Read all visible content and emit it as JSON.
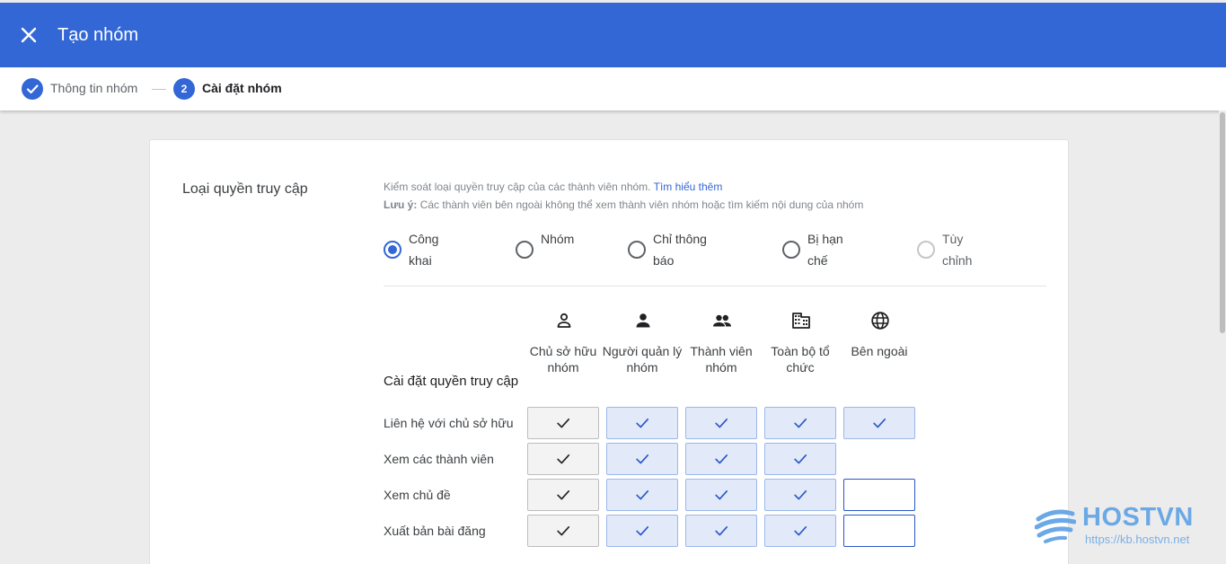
{
  "header": {
    "title": "Tạo nhóm",
    "close_icon": "close-icon"
  },
  "stepper": {
    "steps": [
      {
        "label": "Thông tin nhóm",
        "state": "done",
        "icon": "check-icon"
      },
      {
        "label": "Cài đặt nhóm",
        "number": "2",
        "state": "active"
      }
    ]
  },
  "access": {
    "section_title": "Loại quyền truy cập",
    "description": "Kiểm soát loại quyền truy cập của các thành viên nhóm.",
    "learn_more": "Tìm hiểu thêm",
    "note_label": "Lưu ý:",
    "note_text": "Các thành viên bên ngoài không thể xem thành viên nhóm hoặc tìm kiếm nội dung của nhóm",
    "options": [
      {
        "line1": "Công",
        "line2": "khai",
        "selected": true
      },
      {
        "line1": "Nhóm",
        "line2": "",
        "selected": false
      },
      {
        "line1": "Chỉ thông",
        "line2": "báo",
        "selected": false
      },
      {
        "line1": "Bị hạn",
        "line2": "chế",
        "selected": false
      },
      {
        "line1": "Tùy",
        "line2": "chỉnh",
        "selected": false,
        "disabled": true
      }
    ]
  },
  "permissions": {
    "title": "Cài đặt quyền truy cập",
    "columns": [
      {
        "label": "Chủ sở hữu nhóm",
        "icon": "person-outline-icon"
      },
      {
        "label": "Người quản lý nhóm",
        "icon": "person-icon"
      },
      {
        "label": "Thành viên nhóm",
        "icon": "people-icon"
      },
      {
        "label": "Toàn bộ tổ chức",
        "icon": "building-icon"
      },
      {
        "label": "Bên ngoài",
        "icon": "globe-icon"
      }
    ],
    "rows": [
      {
        "label": "Liên hệ với chủ sở hữu",
        "cells": [
          "checked",
          "checked",
          "checked",
          "checked",
          "checked"
        ]
      },
      {
        "label": "Xem các thành viên",
        "cells": [
          "checked",
          "checked",
          "checked",
          "checked",
          "none"
        ]
      },
      {
        "label": "Xem chủ đề",
        "cells": [
          "checked",
          "checked",
          "checked",
          "checked",
          "unchecked"
        ]
      },
      {
        "label": "Xuất bản bài đăng",
        "cells": [
          "checked",
          "checked",
          "checked",
          "checked",
          "unchecked"
        ]
      }
    ]
  },
  "watermark": {
    "brand": "HOSTVN",
    "url": "https://kb.hostvn.net"
  },
  "colors": {
    "primary": "#3367d6",
    "checked_bg": "#e2eaf9",
    "owner_bg": "#f3f3f3"
  }
}
